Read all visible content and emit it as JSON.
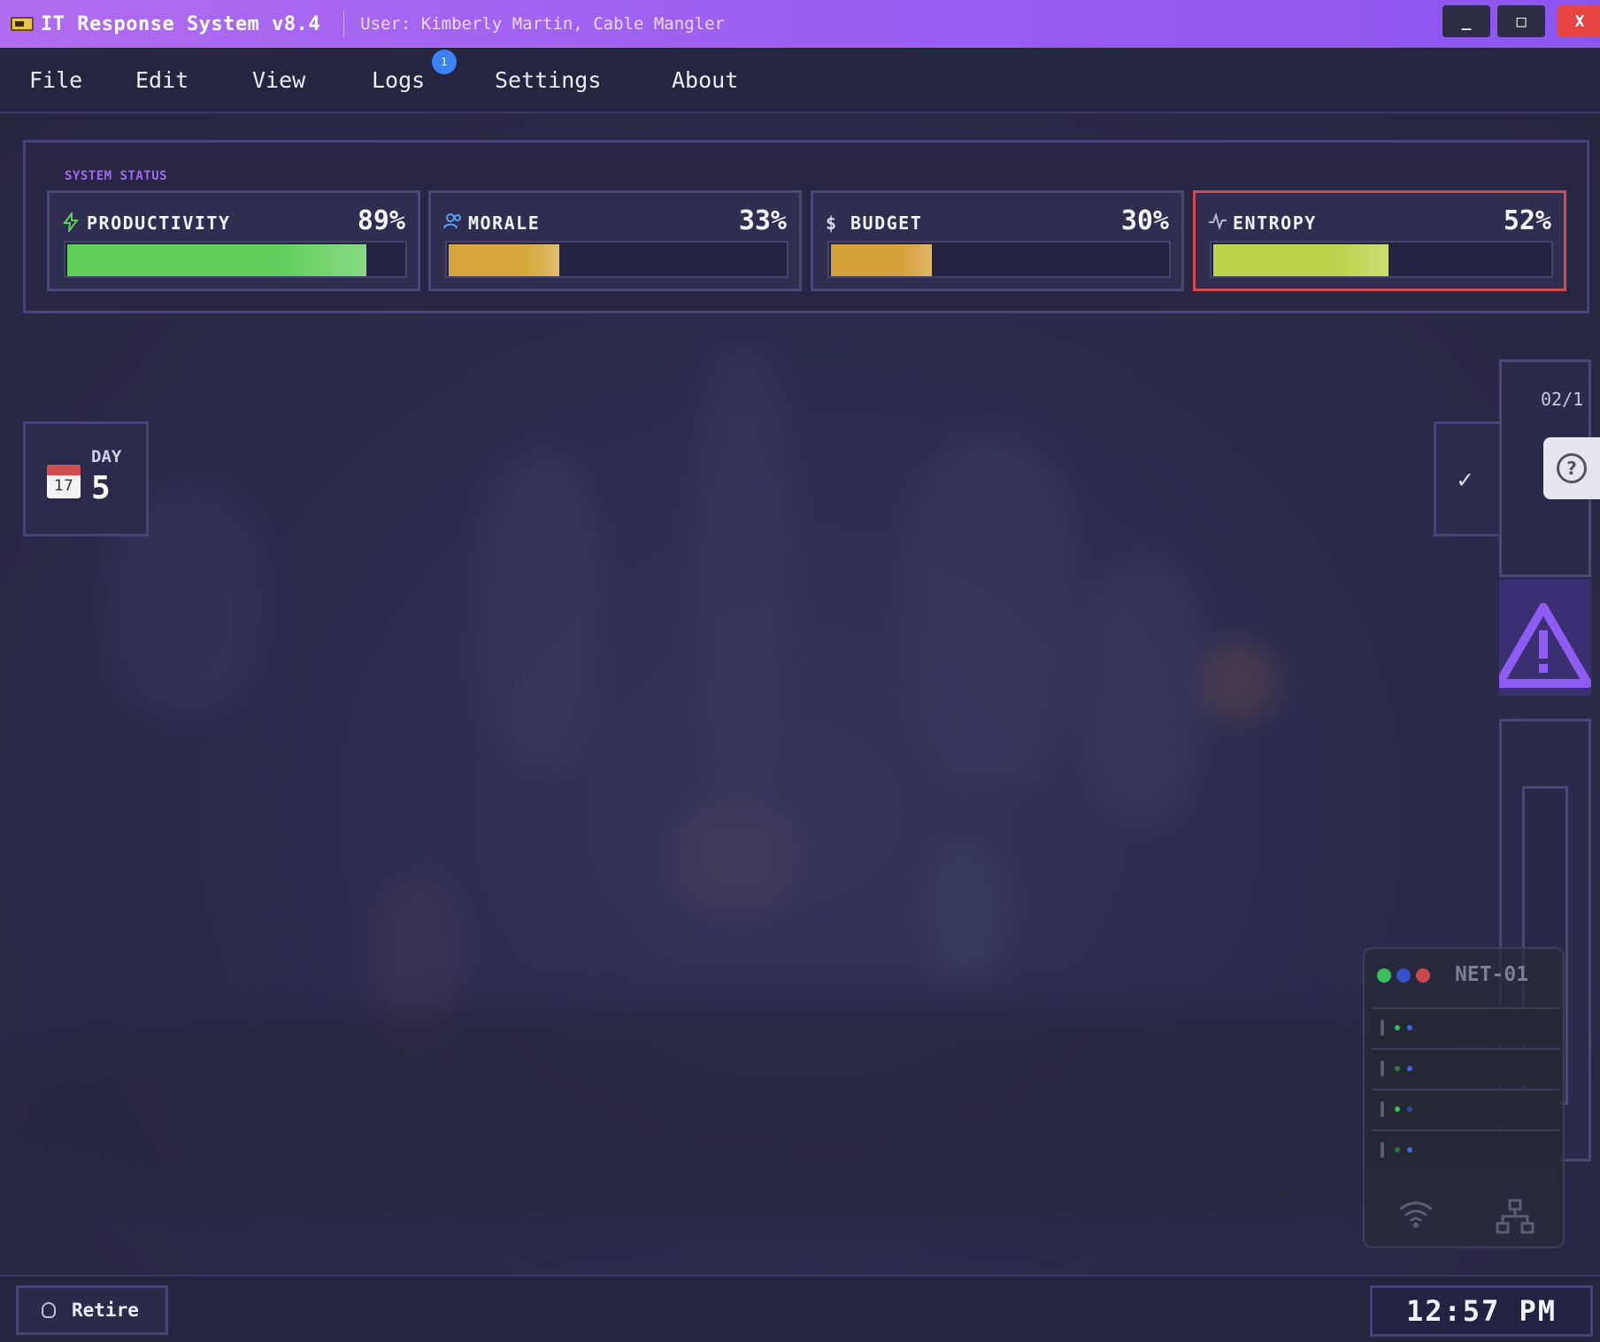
{
  "window": {
    "title": "IT Response System v8.4",
    "user": "User: Kimberly Martin, Cable Mangler",
    "controls": {
      "minimize": "_",
      "maximize": "□",
      "close": "X"
    }
  },
  "menu": {
    "items": [
      "File",
      "Edit",
      "View",
      "Logs",
      "Settings",
      "About"
    ],
    "logs_badge": "1"
  },
  "status": {
    "title": "SYSTEM STATUS",
    "stats": [
      {
        "label": "PRODUCTIVITY",
        "value": "89%",
        "fraction": 0.89,
        "icon": "lightning-icon",
        "color": "#5fcf5a"
      },
      {
        "label": "MORALE",
        "value": "33%",
        "fraction": 0.33,
        "icon": "users-icon",
        "color": "#d4a83c"
      },
      {
        "label": "BUDGET",
        "value": "30%",
        "fraction": 0.3,
        "icon": "dollar-icon",
        "color": "#d4a03a"
      },
      {
        "label": "ENTROPY",
        "value": "52%",
        "fraction": 0.52,
        "icon": "activity-icon",
        "color": "#bcd24a",
        "highlighted": true
      }
    ]
  },
  "day": {
    "label": "DAY",
    "value": "5",
    "calendar_number": "17"
  },
  "right_panel": {
    "date": "02/1"
  },
  "net": {
    "title": "NET-01"
  },
  "bottom": {
    "retire_label": "Retire",
    "clock": "12:57 PM"
  }
}
